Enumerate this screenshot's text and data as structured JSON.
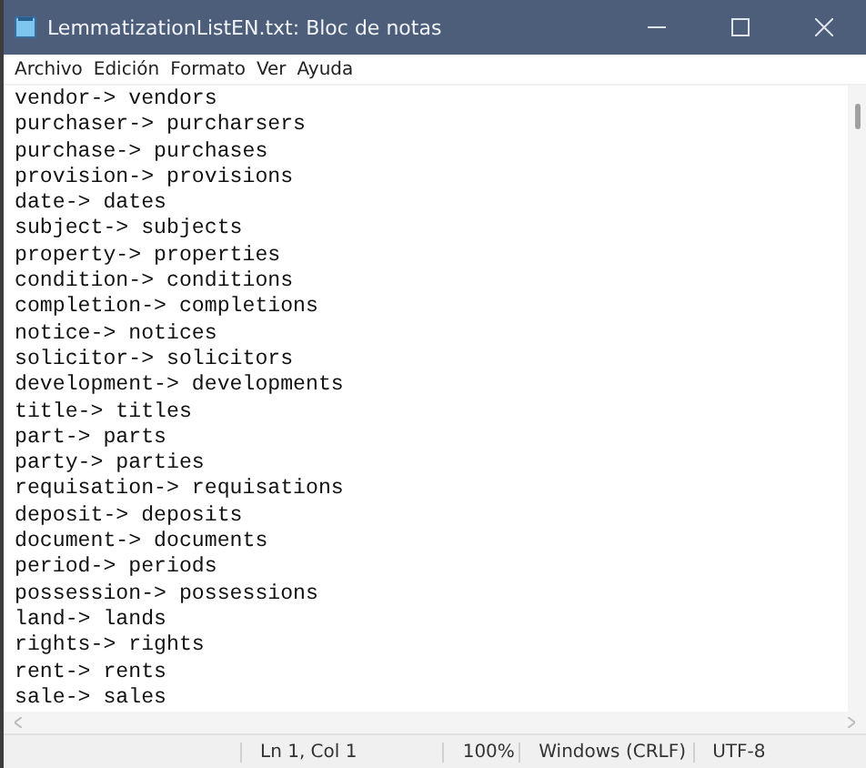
{
  "window": {
    "title": "LemmatizationListEN.txt: Bloc de notas"
  },
  "menu": [
    "Archivo",
    "Edición",
    "Formato",
    "Ver",
    "Ayuda"
  ],
  "lines": [
    "vendor-> vendors",
    "purchaser-> purcharsers",
    "purchase-> purchases",
    "provision-> provisions",
    "date-> dates",
    "subject-> subjects",
    "property-> properties",
    "condition-> conditions",
    "completion-> completions",
    "notice-> notices",
    "solicitor-> solicitors",
    "development-> developments",
    "title-> titles",
    "part-> parts",
    "party-> parties",
    "requisation-> requisations",
    "deposit-> deposits",
    "document-> documents",
    "period-> periods",
    "possession-> possessions",
    "land-> lands",
    "rights-> rights",
    "rent-> rents",
    "sale-> sales"
  ],
  "status_bar": [
    "Ln 1, Col 1",
    "100%",
    "Windows (CRLF)",
    "UTF-8"
  ]
}
